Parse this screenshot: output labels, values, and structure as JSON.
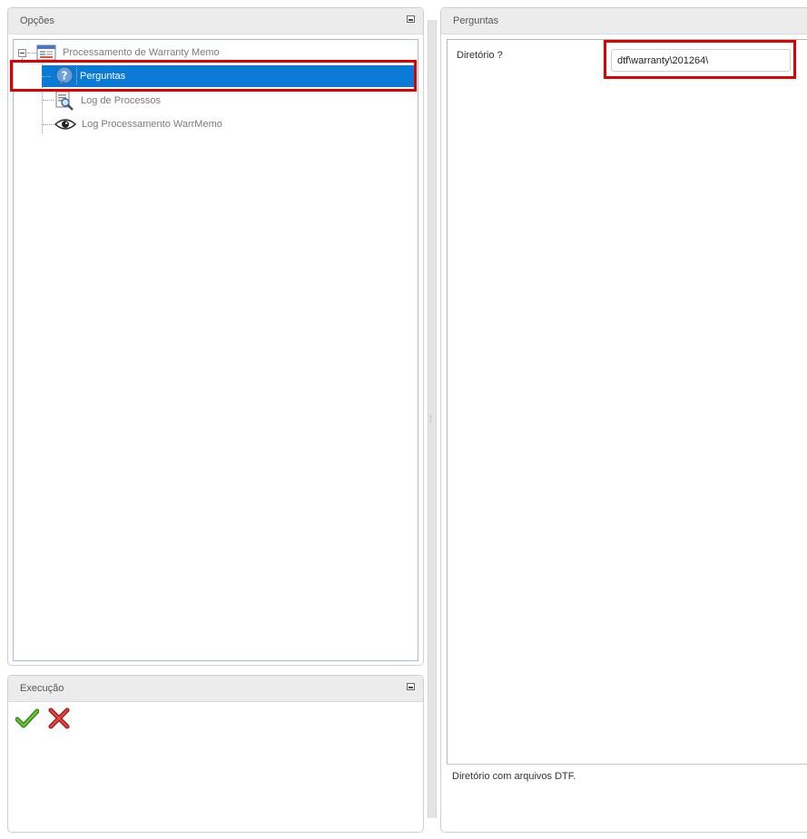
{
  "options_panel": {
    "title": "Opções",
    "tree": {
      "root": {
        "label": "Processamento de Warranty Memo",
        "icon": "window-form-icon"
      },
      "children": [
        {
          "label": "Perguntas",
          "icon": "question-bubble-icon",
          "selected": true
        },
        {
          "label": "Log de Processos",
          "icon": "document-magnifier-icon",
          "selected": false
        },
        {
          "label": "Log Processamento WarrMemo",
          "icon": "eye-icon",
          "selected": false
        }
      ]
    }
  },
  "execution_panel": {
    "title": "Execução",
    "confirm_icon": "green-check-icon",
    "cancel_icon": "red-x-icon"
  },
  "questions_panel": {
    "title": "Perguntas",
    "field": {
      "label": "Diretório ?",
      "value": "dtf\\warranty\\201264\\"
    },
    "help_text": "Diretório com arquivos DTF."
  },
  "colors": {
    "selection": "#0a7ad6",
    "highlight_box": "#e00000",
    "tree_border": "#a3bedb",
    "confirm": "#3d9a1f",
    "cancel": "#d02020"
  }
}
